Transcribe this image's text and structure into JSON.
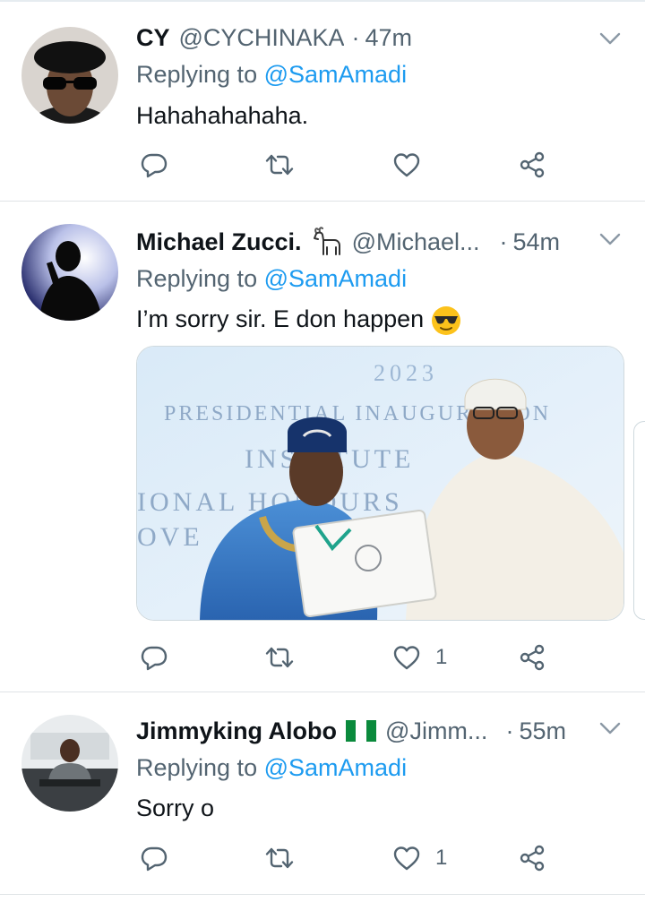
{
  "tweets": [
    {
      "name": "CY",
      "handle": "@CYCHINAKA",
      "separator": "·",
      "time": "47m",
      "replying_prefix": "Replying to",
      "replying_to": "@SamAmadi",
      "text": "Hahahahahaha.",
      "likes": ""
    },
    {
      "name": "Michael Zucci.",
      "handle": "@Michael...",
      "separator": "·",
      "time": "54m",
      "replying_prefix": "Replying to",
      "replying_to": "@SamAmadi",
      "text": "I’m sorry sir. E don happen",
      "likes": "1",
      "media_text": {
        "year": "2023",
        "line1": "PRESIDENTIAL INAUGURATION",
        "line2": "INSTITUTE",
        "line3": "IONAL HONOURS",
        "line4": "OVE"
      }
    },
    {
      "name": "Jimmyking Alobo",
      "handle": "@Jimm...",
      "separator": "·",
      "time": "55m",
      "replying_prefix": "Replying to",
      "replying_to": "@SamAmadi",
      "text": "Sorry o",
      "likes": "1"
    }
  ],
  "colors": {
    "accent": "#1d9bf0",
    "secondary_text": "#536471",
    "primary_text": "#0f1419",
    "divider": "#dfe3e6"
  },
  "icons": {
    "reply": "reply-icon",
    "retweet": "retweet-icon",
    "like": "like-icon",
    "share": "share-icon",
    "more": "chevron-down-icon"
  }
}
